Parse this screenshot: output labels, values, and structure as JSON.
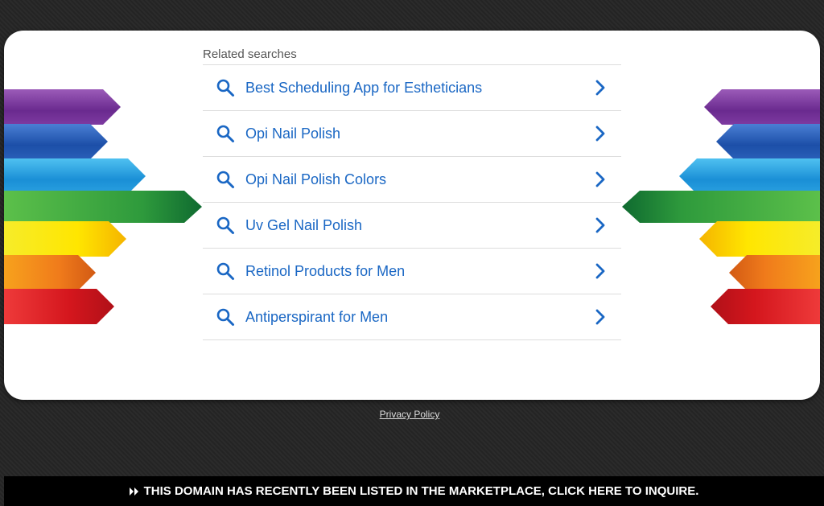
{
  "related": {
    "title": "Related searches",
    "items": [
      {
        "label": "Best Scheduling App for Estheticians"
      },
      {
        "label": "Opi Nail Polish"
      },
      {
        "label": "Opi Nail Polish Colors"
      },
      {
        "label": "Uv Gel Nail Polish"
      },
      {
        "label": "Retinol Products for Men"
      },
      {
        "label": "Antiperspirant for Men"
      }
    ]
  },
  "footer": {
    "privacy_label": "Privacy Policy"
  },
  "banner": {
    "text": "THIS DOMAIN HAS RECENTLY BEEN LISTED IN THE MARKETPLACE, CLICK HERE TO INQUIRE.",
    "icon": "fast-forward-icon"
  },
  "colors": {
    "link": "#1a67c4",
    "background": "#262626",
    "card": "#ffffff"
  }
}
